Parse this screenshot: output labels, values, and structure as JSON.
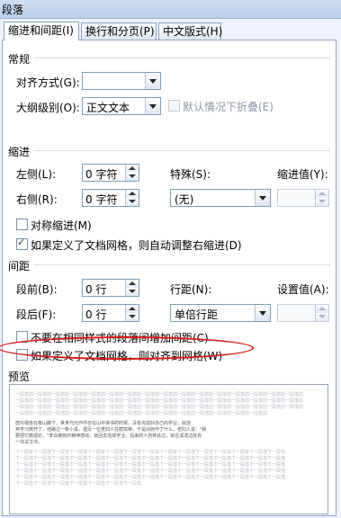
{
  "window": {
    "title": "段落"
  },
  "tabs": [
    {
      "label": "缩进和间距(I)"
    },
    {
      "label": "换行和分页(P)"
    },
    {
      "label": "中文版式(H)"
    }
  ],
  "general": {
    "heading": "常规",
    "alignment_label": "对齐方式(G):",
    "alignment_value": "",
    "outline_label": "大纲级别(O):",
    "outline_value": "正文文本",
    "collapse_label": "默认情况下折叠(E)"
  },
  "indent": {
    "heading": "缩进",
    "left_label": "左侧(L):",
    "left_value": "0 字符",
    "right_label": "右侧(R):",
    "right_value": "0 字符",
    "special_label": "特殊(S):",
    "special_value": "(无)",
    "by_label": "缩进值(Y):",
    "by_value": "",
    "mirror_label": "对称缩进(M)",
    "mirror_checked": false,
    "auto_adjust_label": "如果定义了文档网格，则自动调整右缩进(D)",
    "auto_adjust_checked": true
  },
  "spacing": {
    "heading": "间距",
    "before_label": "段前(B):",
    "before_value": "0 行",
    "after_label": "段后(F):",
    "after_value": "0 行",
    "line_label": "行距(N):",
    "line_value": "单倍行距",
    "at_label": "设置值(A):",
    "at_value": "",
    "no_space_label": "不要在相同样式的段落间增加间距(C)",
    "no_space_checked": false,
    "snap_grid_label": "如果定义了文档网格，则对齐到网格(W)",
    "snap_grid_checked": false
  },
  "preview": {
    "heading": "预览",
    "lines": [
      "一段落前一段落前一段落前一段落前一段落前一段落前一段落前一段落前一段落前一段落前一段落前一段落前一段落前一段落前一段落前一段落前",
      "一段落前一段落前一段落前一段落前一段落前一段落前一段落前一段落前一段落前一段落前一段落前一段落前一段落前一段落前一段落前一段落前",
      "一段落前一段落前一段落前一段落前一段落前一段落前一段落前一段落前一段落前一段落前一段落前一段落前一段落前一段落前一段落前一段落前",
      "一段落前一段落前一段落前一段落前一段落前一段落前一段落前一段落前一段落前一段落前一段落前一段落前一段落前一段落前",
      "唐玲端坐在泰山脚下，世世代代作件自在山中读书的时候，没有完成好自己的学业，就放",
      "弃学习离开了，他路过一条小溪，遇见一位老妇人在磨铁棒，于是对她作了什么，老妇人说：\"我",
      "要把它磨成针。\"李白被她的精神感动，就回去完成学业，后来的人自称此过，就在溪滨边处有",
      "一块试汉书。",
      "下一段落下一段落下一段落下一段落下一段落下一段落下一段落下一段落下一段落下一段落下一段落下一段落下一段落下一段落下一段落",
      "下一段落下一段落下一段落下一段落下一段落下一段落下一段落下一段落下一段落下一段落下一段落下一段落下一段落下一段落下一段落",
      "下一段落下一段落下一段落下一段落下一段落下一段落下一段落下一段落下一段落下一段落下一段落下一段落下一段落下一段落下一段落",
      "下一段落下一段落下一段落下一段落下一段落下一段落下一段落下一段落下一段落下一段落下一段落下一段落下一段落下一段落下一段落",
      "下一段落下一段落下一段落下一段落下一段落下一段落下一段落下一段落下一段落下一段落下一段落下一段落下一段落下一段落下一段落",
      "下一段落下一段落下一段落下一段落下一段落下一段落下一段落"
    ]
  }
}
